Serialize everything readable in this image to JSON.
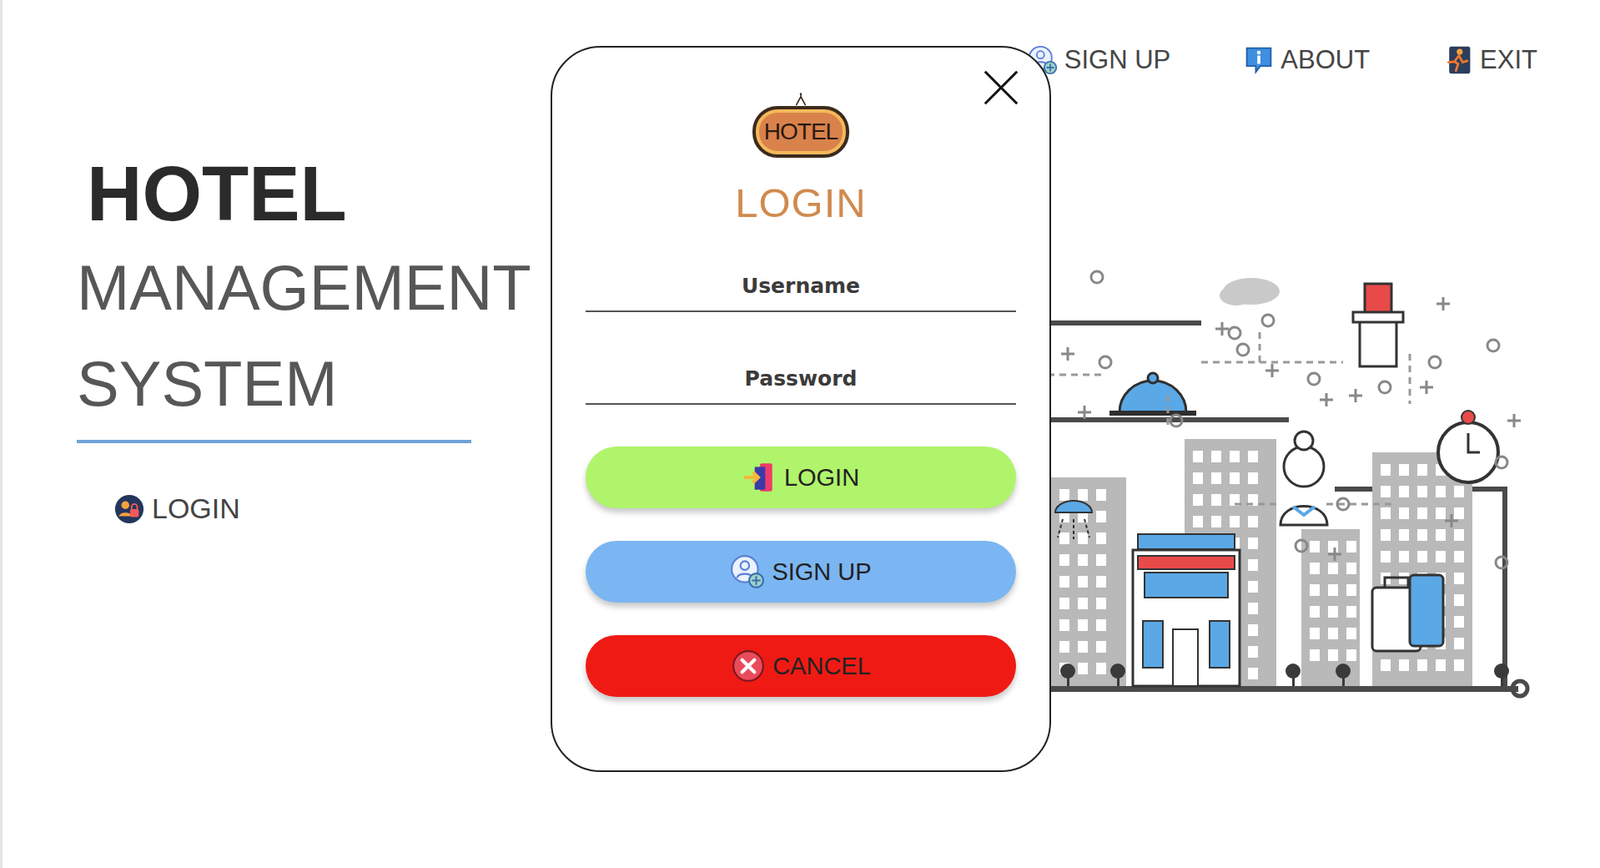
{
  "app": {
    "title_lines": [
      "HOTEL",
      "MANAGEMENT",
      "SYSTEM"
    ],
    "login_link": "LOGIN"
  },
  "nav": [
    {
      "label": "SIGN UP",
      "kind": "signup"
    },
    {
      "label": "ABOUT",
      "kind": "about"
    },
    {
      "label": "EXIT",
      "kind": "exit"
    }
  ],
  "dialog": {
    "logo_text": "HOTEL",
    "title": "LOGIN",
    "fields": [
      {
        "label": "Username"
      },
      {
        "label": "Password"
      }
    ],
    "buttons": [
      {
        "label": "LOGIN",
        "kind": "login",
        "color": "#b0f46b"
      },
      {
        "label": "SIGN UP",
        "kind": "signup",
        "color": "#7bb6f2"
      },
      {
        "label": "CANCEL",
        "kind": "cancel",
        "color": "#f01a14"
      }
    ]
  }
}
